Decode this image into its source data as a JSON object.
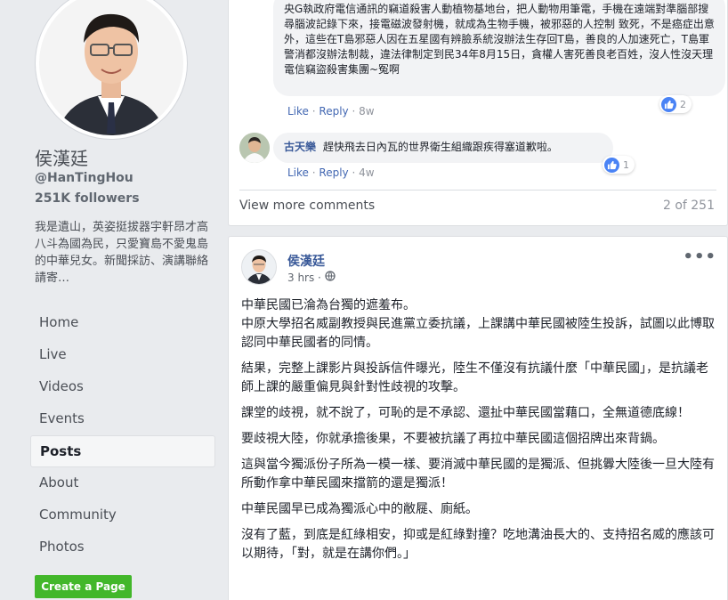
{
  "profile": {
    "name": "侯漢廷",
    "handle": "@HanTingHou",
    "followers": "251K followers",
    "bio": "我是遺山，英姿挺拔器宇軒昂才高八斗為國為民，只愛寶島不愛鬼島的中華兒女。新聞採訪、演講聯絡請寄…"
  },
  "nav": {
    "items": [
      "Home",
      "Live",
      "Videos",
      "Events",
      "Posts",
      "About",
      "Community",
      "Photos"
    ],
    "active": "Posts",
    "create_page": "Create a Page"
  },
  "comments": {
    "first": {
      "text": "央G執政府電信通訊的竊道殺害人動植物基地台，把人動物用筆電，手機在遠端對準腦部搜尋腦波記錄下來，接電磁波發射機，就成為生物手機，被邪惡的人控制 致死，不是癌症出意外，這些在T島邪惡人因在五星國有辨臉系統沒辦法生存回T島，善良的人加速死亡，T島軍警消都沒辦法制裁，違法律制定到民34年8月15日，貪權人害死善良老百姓，沒人性沒天理電信竊盜殺害集團~冤啊",
      "like": "Like",
      "reply": "Reply",
      "time": "8w",
      "reactions": "2"
    },
    "second": {
      "author": "古天樂",
      "text": "趕快飛去日內瓦的世界衛生組織跟疾得塞道歉啦。",
      "like": "Like",
      "reply": "Reply",
      "time": "4w",
      "reactions": "1"
    },
    "view_more": "View more comments",
    "count": "2 of 251"
  },
  "post": {
    "author": "侯漢廷",
    "time": "3 hrs ·",
    "menu": "•••",
    "paragraphs": [
      "中華民國已淪為台獨的遮羞布。\n中原大學招名威副教授與民進黨立委抗議，上課講中華民國被陸生投訴，試圖以此博取認同中華民國者的同情。",
      "結果，完整上課影片與投訴信件曝光，陸生不僅沒有抗議什麼「中華民國」，是抗議老師上課的嚴重偏見與針對性歧視的攻擊。",
      "課堂的歧視，就不說了，可恥的是不承認、還扯中華民國當藉口，全無道德底線！",
      "要歧視大陸，你就承擔後果，不要被抗議了再拉中華民國這個招牌出來背鍋。",
      "這與當今獨派份子所為一模一樣、要消滅中華民國的是獨派、但挑釁大陸後一旦大陸有所動作拿中華民國來擋箭的還是獨派！",
      "中華民國早已成為獨派心中的敝屣、廁紙。",
      "沒有了藍，到底是紅綠相安，抑或是紅綠對撞？吃地溝油長大的、支持招名威的應該可以期待，「對，就是在講你們。」"
    ]
  },
  "colors": {
    "link": "#385898",
    "action": "#4267b2",
    "create_button": "#42b72a",
    "background": "#e9ebee"
  }
}
